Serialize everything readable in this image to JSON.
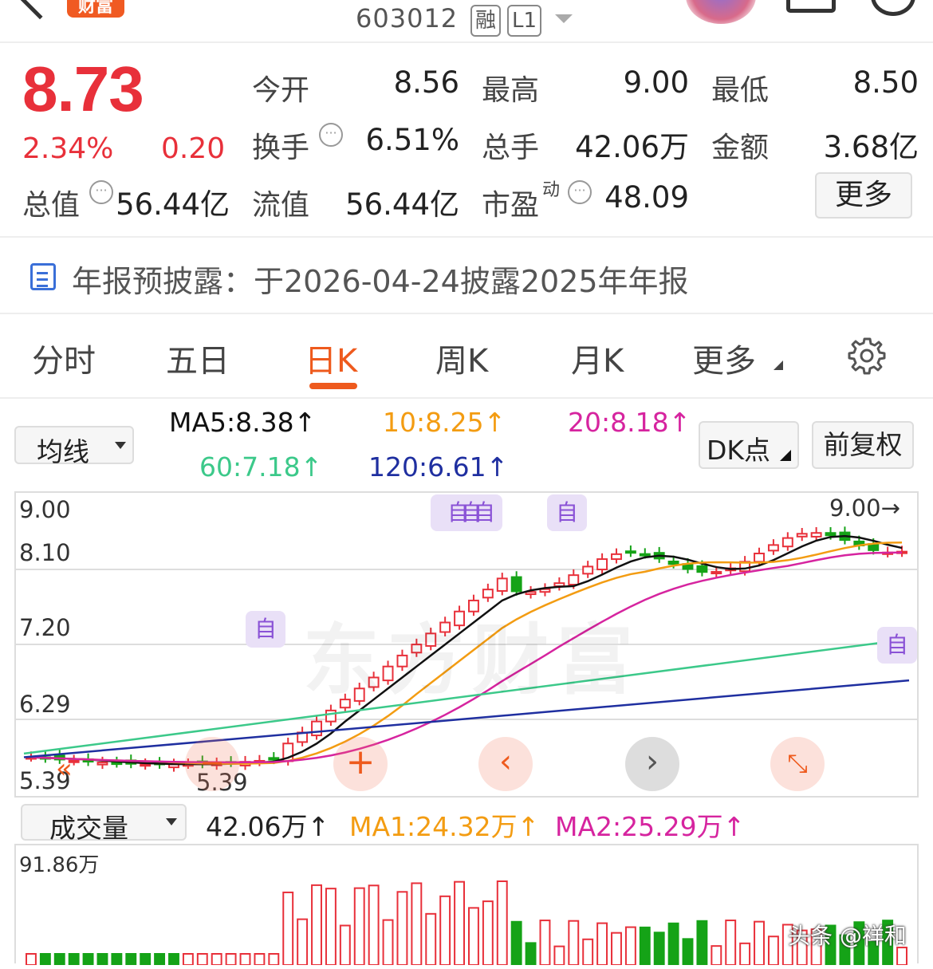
{
  "header": {
    "brand_badge": "财富",
    "stock_code": "603012",
    "tag_margin": "融",
    "tag_level": "L1"
  },
  "quote": {
    "price": "8.73",
    "change_pct": "2.34%",
    "change_abs": "0.20",
    "open_label": "今开",
    "open_value": "8.56",
    "high_label": "最高",
    "high_value": "9.00",
    "low_label": "最低",
    "low_value": "8.50",
    "turnover_label": "换手",
    "turnover_value": "6.51%",
    "volume_label": "总手",
    "volume_value": "42.06万",
    "amount_label": "金额",
    "amount_value": "3.68亿",
    "mktcap_label": "总值",
    "mktcap_value": "56.44亿",
    "float_label": "流值",
    "float_value": "56.44亿",
    "pe_label": "市盈",
    "pe_sup": "动",
    "pe_value": "48.09",
    "more_button": "更多"
  },
  "notice": {
    "text": "年报预披露：于2026-04-24披露2025年年报"
  },
  "tabs": [
    {
      "label": "分时"
    },
    {
      "label": "五日"
    },
    {
      "label": "日K",
      "active": true
    },
    {
      "label": "周K"
    },
    {
      "label": "月K"
    },
    {
      "label": "更多"
    }
  ],
  "ma": {
    "dropdown": "均线",
    "ma5": "MA5:8.38↑",
    "ma10": "10:8.25↑",
    "ma20": "20:8.18↑",
    "ma60": "60:7.18↑",
    "ma120": "120:6.61↑",
    "dk_button": "DK点",
    "adjust_button": "前复权",
    "colors": {
      "ma5": "#111111",
      "ma10": "#f39c12",
      "ma20": "#d6249f",
      "ma60": "#3cc98a",
      "ma120": "#1f2fa0",
      "up": "#e8303a",
      "down": "#15a317"
    }
  },
  "kline": {
    "y_labels": [
      "9.00",
      "8.10",
      "7.20",
      "6.29",
      "5.39"
    ],
    "high_marker": "9.00→",
    "low_marker": "5.39",
    "event_marker": "自",
    "watermark": "东方财富"
  },
  "volume": {
    "dropdown": "成交量",
    "value": "42.06万↑",
    "ma1": "MA1:24.32万↑",
    "ma2": "MA2:25.29万↑",
    "max_label": "91.86万"
  },
  "footer": {
    "watermark": "头条 @祥和"
  }
}
